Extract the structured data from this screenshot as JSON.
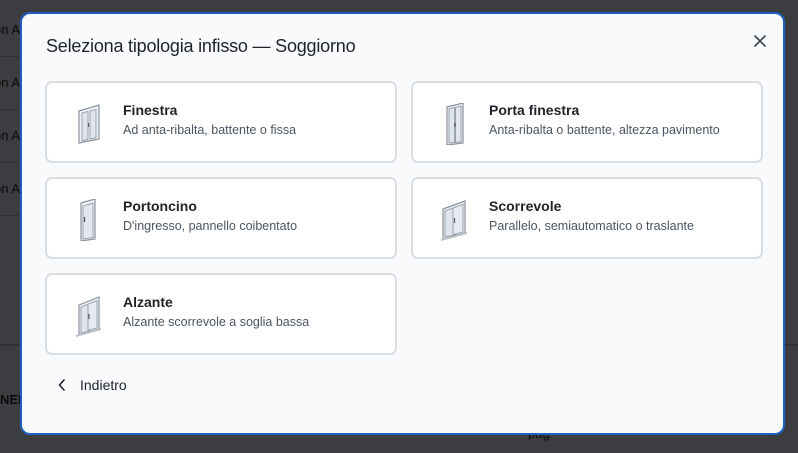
{
  "background": {
    "rows": [
      "on A",
      "on A",
      "on A",
      "on A"
    ],
    "footer_label": "NEN",
    "bottom_text": "pag"
  },
  "modal": {
    "title": "Seleziona tipologia infisso — Soggiorno",
    "close_icon": "close-icon",
    "back_label": "Indietro",
    "accent_color": "#1f5fc2",
    "options": [
      {
        "title": "Finestra",
        "description": "Ad anta-ribalta, battente o fissa",
        "icon": "window-icon"
      },
      {
        "title": "Porta finestra",
        "description": "Anta-ribalta o battente, altezza pavimento",
        "icon": "french-door-icon"
      },
      {
        "title": "Portoncino",
        "description": "D'ingresso, pannello coibentato",
        "icon": "entrance-door-icon"
      },
      {
        "title": "Scorrevole",
        "description": "Parallelo, semiautomatico o traslante",
        "icon": "sliding-window-icon"
      },
      {
        "title": "Alzante",
        "description": "Alzante scorrevole a soglia bassa",
        "icon": "lift-slide-icon"
      }
    ]
  }
}
